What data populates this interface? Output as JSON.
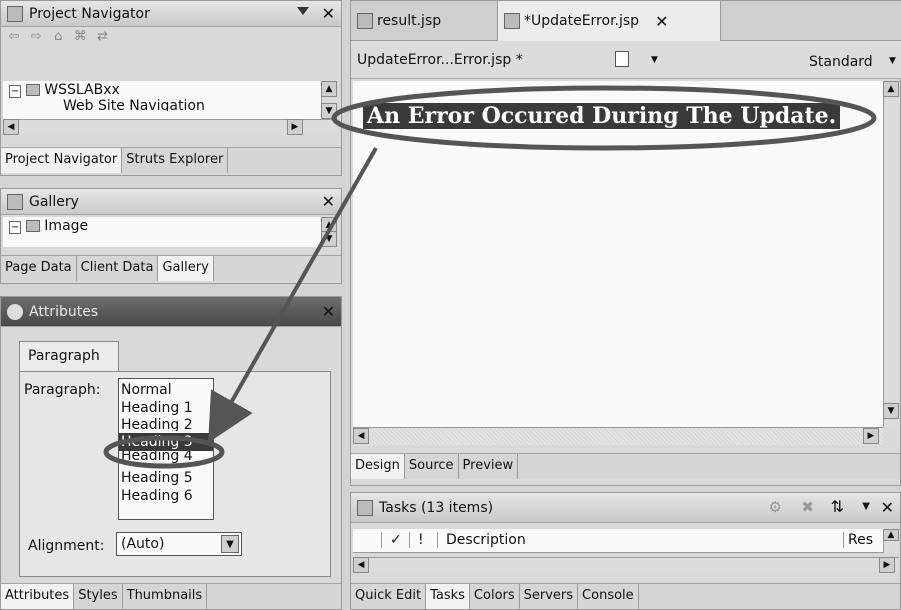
{
  "project_navigator": {
    "title": "Project Navigator",
    "tree": [
      "WSSLABxx",
      "Web Site Navigation"
    ],
    "tabs": [
      "Project Navigator",
      "Struts Explorer"
    ]
  },
  "gallery": {
    "title": "Gallery",
    "tree": [
      "Image"
    ],
    "tabs": [
      "Page Data",
      "Client Data",
      "Gallery"
    ]
  },
  "attributes": {
    "title": "Attributes",
    "inner_tab": "Paragraph",
    "paragraph_label": "Paragraph:",
    "paragraph_options": [
      "Normal",
      "Heading 1",
      "Heading 2",
      "Heading 3",
      "Heading 4",
      "Heading 5",
      "Heading 6"
    ],
    "selected": "Heading 3",
    "alignment_label": "Alignment:",
    "alignment_value": "(Auto)",
    "tabs": [
      "Attributes",
      "Styles",
      "Thumbnails"
    ]
  },
  "editor": {
    "tabs": [
      "result.jsp",
      "*UpdateError.jsp"
    ],
    "file_label": "UpdateError...Error.jsp *",
    "standard_label": "Standard",
    "heading_text": "An Error Occured During The Update.",
    "bottom_tabs": [
      "Design",
      "Source",
      "Preview"
    ]
  },
  "tasks": {
    "title": "Tasks (13 items)",
    "col_check": "✓",
    "col_bang": "!",
    "col_desc": "Description",
    "col_res": "Res",
    "bottom_tabs": [
      "Quick Edit",
      "Tasks",
      "Colors",
      "Servers",
      "Console"
    ]
  },
  "colors": {
    "highlight": "#3a3a3a",
    "annotation": "#555555"
  }
}
